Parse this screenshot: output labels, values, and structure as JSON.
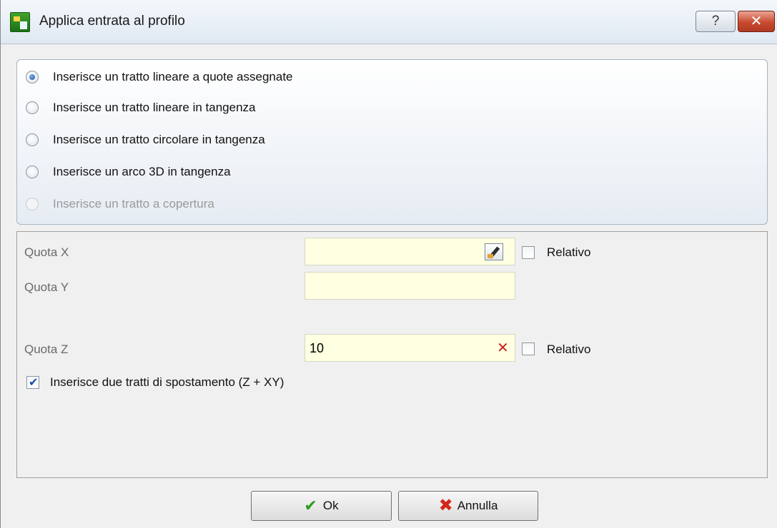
{
  "window": {
    "title": "Applica entrata al profilo",
    "help_label": "?",
    "close_label": "✕"
  },
  "options": [
    {
      "label": "Inserisce un tratto lineare a quote assegnate",
      "selected": true,
      "enabled": true
    },
    {
      "label": "Inserisce un tratto lineare in tangenza",
      "selected": false,
      "enabled": true
    },
    {
      "label": "Inserisce un tratto circolare in tangenza",
      "selected": false,
      "enabled": true
    },
    {
      "label": "Inserisce un arco 3D in tangenza",
      "selected": false,
      "enabled": true
    },
    {
      "label": "Inserisce un tratto a copertura",
      "selected": false,
      "enabled": false
    }
  ],
  "fields": {
    "quota_x": {
      "label": "Quota X",
      "value": "",
      "relative_label": "Relativo",
      "relative_checked": false
    },
    "quota_y": {
      "label": "Quota Y",
      "value": ""
    },
    "quota_z": {
      "label": "Quota Z",
      "value": "10",
      "relative_label": "Relativo",
      "relative_checked": false
    }
  },
  "two_moves": {
    "label": "Inserisce due tratti di spostamento (Z + XY)",
    "checked": true
  },
  "buttons": {
    "ok_label": "Ok",
    "cancel_label": "Annulla"
  }
}
